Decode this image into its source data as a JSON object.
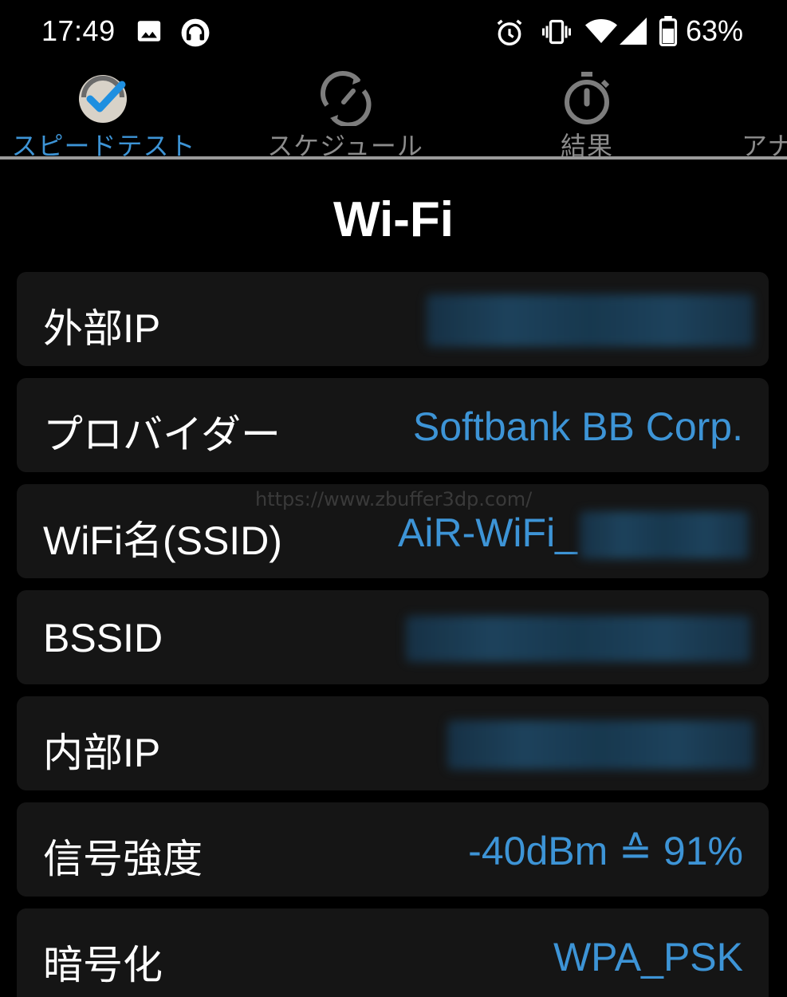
{
  "status_bar": {
    "time": "17:49",
    "battery_percent": "63%",
    "icons": [
      "image-icon",
      "headset-icon",
      "alarm-icon",
      "vibrate-icon",
      "wifi-icon",
      "signal-icon",
      "battery-icon"
    ]
  },
  "tabs": [
    {
      "label": "スピードテスト",
      "icon": "speedtest-check-icon",
      "active": true
    },
    {
      "label": "スケジュール",
      "icon": "schedule-gauge-icon",
      "active": false
    },
    {
      "label": "結果",
      "icon": "stopwatch-icon",
      "active": false
    },
    {
      "label": "アナ",
      "icon": "",
      "active": false
    }
  ],
  "section_title": "Wi-Fi",
  "rows": [
    {
      "label": "外部IP",
      "value": ""
    },
    {
      "label": "プロバイダー",
      "value": "Softbank BB Corp."
    },
    {
      "label": "WiFi名(SSID)",
      "value": "AiR-WiFi_"
    },
    {
      "label": "BSSID",
      "value": ""
    },
    {
      "label": "内部IP",
      "value": ""
    },
    {
      "label": "信号強度",
      "value": "-40dBm ≙ 91%"
    },
    {
      "label": "暗号化",
      "value": "WPA_PSK"
    }
  ],
  "watermark": "https://www.zbuffer3dp.com/",
  "colors": {
    "accent": "#3d94d6",
    "card_bg": "#151515",
    "background": "#000000"
  }
}
